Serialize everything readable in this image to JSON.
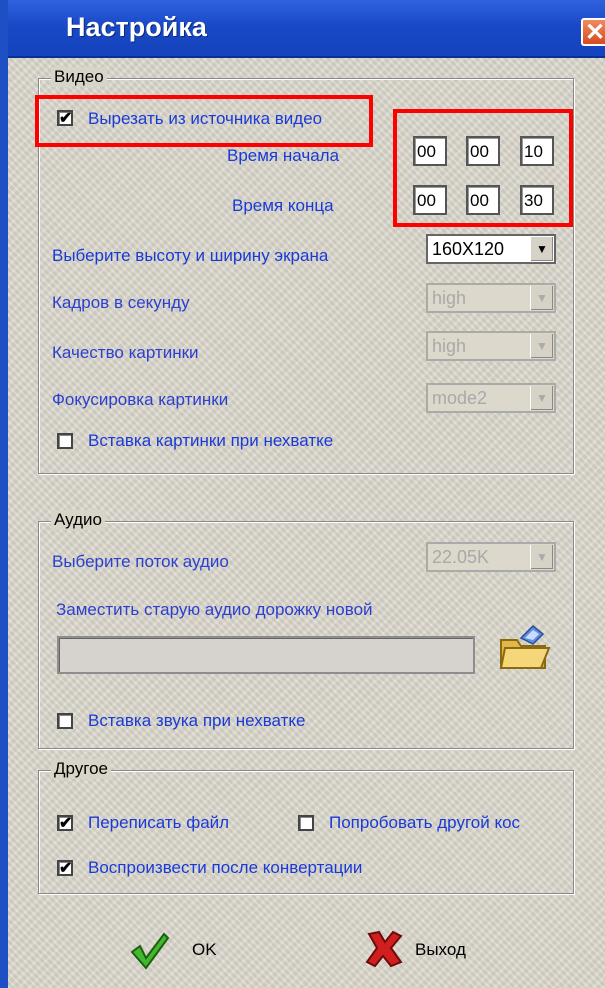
{
  "window": {
    "title": "Настройка",
    "close_glyph": "✕"
  },
  "video": {
    "group_label": "Видео",
    "cut_source_label": "Вырезать из источника видео",
    "cut_source_checked": true,
    "start_time_label": "Время начала",
    "end_time_label": "Время конца",
    "start_time": [
      "00",
      "00",
      "10"
    ],
    "end_time": [
      "00",
      "00",
      "30"
    ],
    "resolution_label": "Выберите высоту и ширину экрана",
    "resolution_value": "160X120",
    "fps_label": "Кадров в секунду",
    "fps_value": "high",
    "quality_label": "Качество картинки",
    "quality_value": "high",
    "focus_label": "Фокусировка картинки",
    "focus_value": "mode2",
    "insert_picture_label": "Вставка картинки при нехватке",
    "insert_picture_checked": false
  },
  "audio": {
    "group_label": "Аудио",
    "stream_label": "Выберите поток аудио",
    "stream_value": "22.05K",
    "replace_label": "Заместить старую аудио дорожку новой",
    "replace_path": "",
    "insert_sound_label": "Вставка звука при нехватке",
    "insert_sound_checked": false
  },
  "other": {
    "group_label": "Другое",
    "overwrite_label": "Переписать файл",
    "overwrite_checked": true,
    "try_codec_label": "Попробовать другой кос",
    "try_codec_checked": false,
    "play_after_label": "Воспроизвести после конвертации",
    "play_after_checked": true
  },
  "buttons": {
    "ok_label": "OK",
    "exit_label": "Выход"
  },
  "icons": {
    "ok": "checkmark-icon",
    "exit": "x-icon",
    "folder": "open-folder-icon"
  },
  "colors": {
    "titlebar": "#1a49c6",
    "label_blue": "#1a3ad8",
    "highlight_red": "#ff0000"
  }
}
